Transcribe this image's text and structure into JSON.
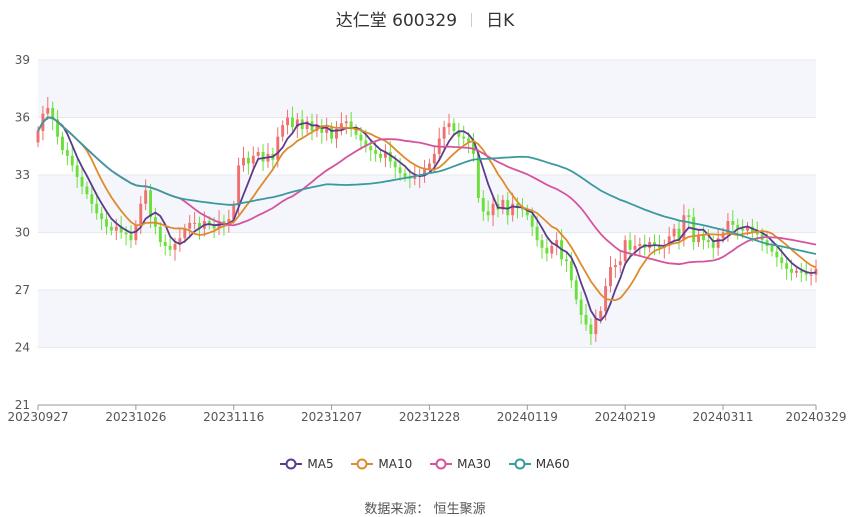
{
  "header": {
    "stock": "达仁堂 600329",
    "period": "日K"
  },
  "legend": [
    {
      "label": "MA5",
      "color": "#5b3b8c"
    },
    {
      "label": "MA10",
      "color": "#e08a2e"
    },
    {
      "label": "MA30",
      "color": "#d4559e"
    },
    {
      "label": "MA60",
      "color": "#3a9aa0"
    }
  ],
  "source": {
    "label": "数据来源：",
    "value": "恒生聚源"
  },
  "colors": {
    "up": "#f07070",
    "down": "#6be03c",
    "grid": "#e6e9f0",
    "plot_bg_alt": "#f5f6fb"
  },
  "chart_data": {
    "type": "candlestick",
    "title": "达仁堂 600329 日K",
    "ylim": [
      21,
      39
    ],
    "yticks": [
      21,
      24,
      27,
      30,
      33,
      36,
      39
    ],
    "x_tick_labels": [
      "20230927",
      "20231026",
      "20231116",
      "20231207",
      "20231228",
      "20240119",
      "20240219",
      "20240311",
      "20240329"
    ],
    "x_tick_index": [
      0,
      20,
      40,
      60,
      80,
      100,
      120,
      140,
      159
    ],
    "candle_count": 160,
    "close": [
      35.3,
      36.2,
      36.5,
      35.9,
      35.0,
      34.3,
      34.0,
      33.5,
      32.9,
      32.4,
      32.0,
      31.5,
      31.0,
      30.7,
      30.3,
      30.1,
      30.3,
      30.0,
      29.9,
      29.6,
      30.4,
      31.5,
      32.2,
      30.8,
      30.3,
      29.5,
      29.3,
      29.1,
      29.4,
      29.7,
      30.2,
      30.5,
      30.5,
      30.2,
      30.6,
      30.4,
      30.2,
      30.6,
      30.4,
      30.7,
      31.4,
      33.5,
      33.9,
      33.6,
      34.0,
      34.2,
      33.7,
      34.1,
      33.8,
      35.0,
      35.6,
      36.0,
      35.5,
      35.9,
      35.4,
      35.8,
      35.3,
      35.6,
      35.2,
      35.5,
      34.9,
      35.4,
      35.7,
      35.8,
      35.4,
      35.1,
      34.8,
      34.5,
      34.3,
      34.1,
      33.9,
      34.2,
      33.7,
      33.4,
      33.1,
      32.9,
      32.8,
      32.9,
      33.0,
      33.3,
      33.6,
      34.1,
      34.9,
      35.5,
      35.7,
      35.3,
      35.0,
      34.9,
      34.7,
      34.1,
      31.8,
      31.1,
      30.9,
      31.5,
      31.2,
      31.7,
      30.9,
      31.5,
      31.3,
      31.2,
      30.9,
      30.3,
      29.6,
      29.2,
      28.9,
      29.3,
      29.6,
      28.6,
      28.5,
      27.5,
      26.5,
      25.7,
      25.2,
      24.7,
      25.5,
      25.9,
      27.2,
      28.2,
      28.3,
      28.5,
      29.6,
      29.1,
      29.3,
      29.4,
      29.2,
      29.5,
      29.3,
      29.2,
      29.3,
      29.8,
      30.2,
      29.6,
      30.9,
      30.8,
      29.5,
      29.9,
      29.6,
      29.5,
      29.2,
      29.7,
      30.0,
      30.6,
      30.4,
      30.2,
      30.1,
      30.3,
      30.0,
      29.9,
      29.6,
      29.3,
      29.0,
      28.7,
      28.4,
      28.1,
      27.9,
      28.0,
      27.9,
      27.8,
      27.8,
      28.1
    ]
  }
}
